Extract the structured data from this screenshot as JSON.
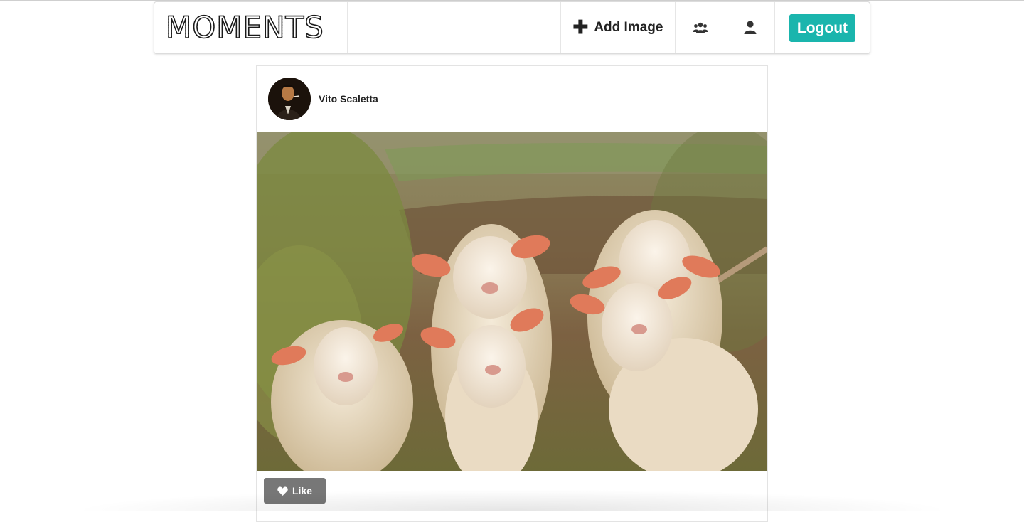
{
  "brand": {
    "logo_text": "MOMENTS"
  },
  "nav": {
    "add_image_label": "Add Image",
    "friends_icon": "users-icon",
    "profile_icon": "user-icon",
    "logout_label": "Logout"
  },
  "post": {
    "author_name": "Vito Scaletta",
    "image_subject": "flock of sheep in a meadow",
    "like_label": "Like"
  },
  "colors": {
    "accent": "#1ab5ad",
    "like_button": "#777777"
  }
}
